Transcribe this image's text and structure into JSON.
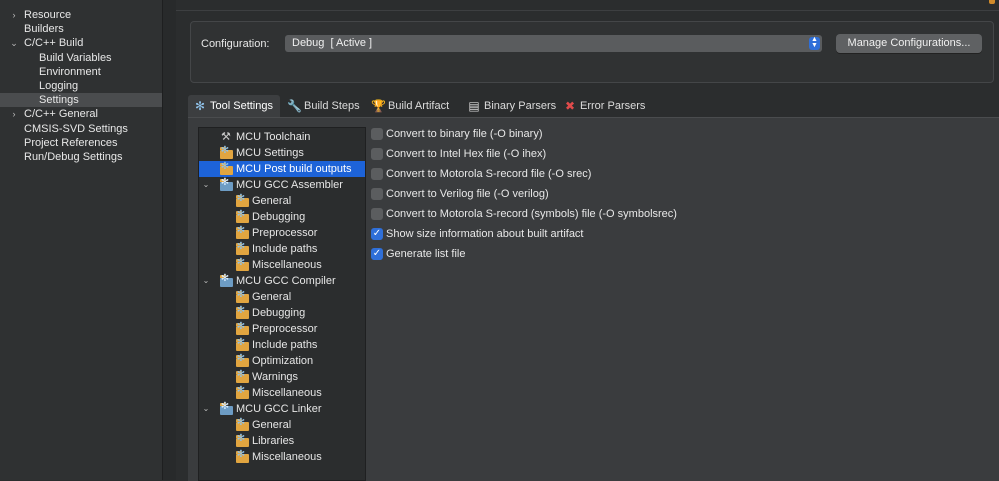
{
  "left_nav": {
    "items": [
      {
        "label": "Resource",
        "chevron": "›",
        "indent": 0,
        "selected": false
      },
      {
        "label": "Builders",
        "chevron": "",
        "indent": 0,
        "selected": false
      },
      {
        "label": "C/C++ Build",
        "chevron": "⌄",
        "indent": 0,
        "selected": false
      },
      {
        "label": "Build Variables",
        "chevron": "",
        "indent": 1,
        "selected": false
      },
      {
        "label": "Environment",
        "chevron": "",
        "indent": 1,
        "selected": false
      },
      {
        "label": "Logging",
        "chevron": "",
        "indent": 1,
        "selected": false
      },
      {
        "label": "Settings",
        "chevron": "",
        "indent": 1,
        "selected": true
      },
      {
        "label": "C/C++ General",
        "chevron": "›",
        "indent": 0,
        "selected": false
      },
      {
        "label": "CMSIS-SVD Settings",
        "chevron": "",
        "indent": 0,
        "selected": false
      },
      {
        "label": "Project References",
        "chevron": "",
        "indent": 0,
        "selected": false
      },
      {
        "label": "Run/Debug Settings",
        "chevron": "",
        "indent": 0,
        "selected": false
      }
    ]
  },
  "configuration": {
    "label": "Configuration:",
    "selected_value": "Debug  [ Active ]",
    "manage_button": "Manage Configurations..."
  },
  "tabs": [
    {
      "label": "Tool Settings",
      "icon": "gear-icon",
      "active": true
    },
    {
      "label": "Build Steps",
      "icon": "wrench-icon",
      "active": false
    },
    {
      "label": "Build Artifact",
      "icon": "trophy-icon",
      "active": false
    },
    {
      "label": "Binary Parsers",
      "icon": "binary-file-icon",
      "active": false
    },
    {
      "label": "Error Parsers",
      "icon": "error-icon",
      "active": false
    }
  ],
  "tool_tree": {
    "items": [
      {
        "label": "MCU Toolchain",
        "level": 0,
        "expandable": false,
        "icon": "hammer-icon",
        "selected": false
      },
      {
        "label": "MCU Settings",
        "level": 0,
        "expandable": false,
        "icon": "folder-gear-icon",
        "selected": false
      },
      {
        "label": "MCU Post build outputs",
        "level": 0,
        "expandable": false,
        "icon": "folder-gear-icon",
        "selected": true
      },
      {
        "label": "MCU GCC Assembler",
        "level": 0,
        "expandable": true,
        "icon": "gear-icon",
        "selected": false
      },
      {
        "label": "General",
        "level": 1,
        "expandable": false,
        "icon": "folder-gear-icon",
        "selected": false
      },
      {
        "label": "Debugging",
        "level": 1,
        "expandable": false,
        "icon": "folder-gear-icon",
        "selected": false
      },
      {
        "label": "Preprocessor",
        "level": 1,
        "expandable": false,
        "icon": "folder-gear-icon",
        "selected": false
      },
      {
        "label": "Include paths",
        "level": 1,
        "expandable": false,
        "icon": "folder-gear-icon",
        "selected": false
      },
      {
        "label": "Miscellaneous",
        "level": 1,
        "expandable": false,
        "icon": "folder-gear-icon",
        "selected": false
      },
      {
        "label": "MCU GCC Compiler",
        "level": 0,
        "expandable": true,
        "icon": "gear-icon",
        "selected": false
      },
      {
        "label": "General",
        "level": 1,
        "expandable": false,
        "icon": "folder-gear-icon",
        "selected": false
      },
      {
        "label": "Debugging",
        "level": 1,
        "expandable": false,
        "icon": "folder-gear-icon",
        "selected": false
      },
      {
        "label": "Preprocessor",
        "level": 1,
        "expandable": false,
        "icon": "folder-gear-icon",
        "selected": false
      },
      {
        "label": "Include paths",
        "level": 1,
        "expandable": false,
        "icon": "folder-gear-icon",
        "selected": false
      },
      {
        "label": "Optimization",
        "level": 1,
        "expandable": false,
        "icon": "folder-gear-icon",
        "selected": false
      },
      {
        "label": "Warnings",
        "level": 1,
        "expandable": false,
        "icon": "folder-gear-icon",
        "selected": false
      },
      {
        "label": "Miscellaneous",
        "level": 1,
        "expandable": false,
        "icon": "folder-gear-icon",
        "selected": false
      },
      {
        "label": "MCU GCC Linker",
        "level": 0,
        "expandable": true,
        "icon": "gear-icon",
        "selected": false
      },
      {
        "label": "General",
        "level": 1,
        "expandable": false,
        "icon": "folder-gear-icon",
        "selected": false
      },
      {
        "label": "Libraries",
        "level": 1,
        "expandable": false,
        "icon": "folder-gear-icon",
        "selected": false
      },
      {
        "label": "Miscellaneous",
        "level": 1,
        "expandable": false,
        "icon": "folder-gear-icon",
        "selected": false
      }
    ]
  },
  "options": [
    {
      "label": "Convert to binary file (-O binary)",
      "checked": false
    },
    {
      "label": "Convert to Intel Hex file (-O ihex)",
      "checked": false
    },
    {
      "label": "Convert to Motorola S-record file (-O srec)",
      "checked": false
    },
    {
      "label": "Convert to Verilog file (-O verilog)",
      "checked": false
    },
    {
      "label": "Convert to Motorola S-record (symbols) file (-O symbolsrec)",
      "checked": false
    },
    {
      "label": "Show size information about built artifact",
      "checked": true
    },
    {
      "label": "Generate list file",
      "checked": true
    }
  ],
  "colors": {
    "accent": "#2f6fd8",
    "selection": "#1d63d8",
    "folder": "#e1a540"
  }
}
